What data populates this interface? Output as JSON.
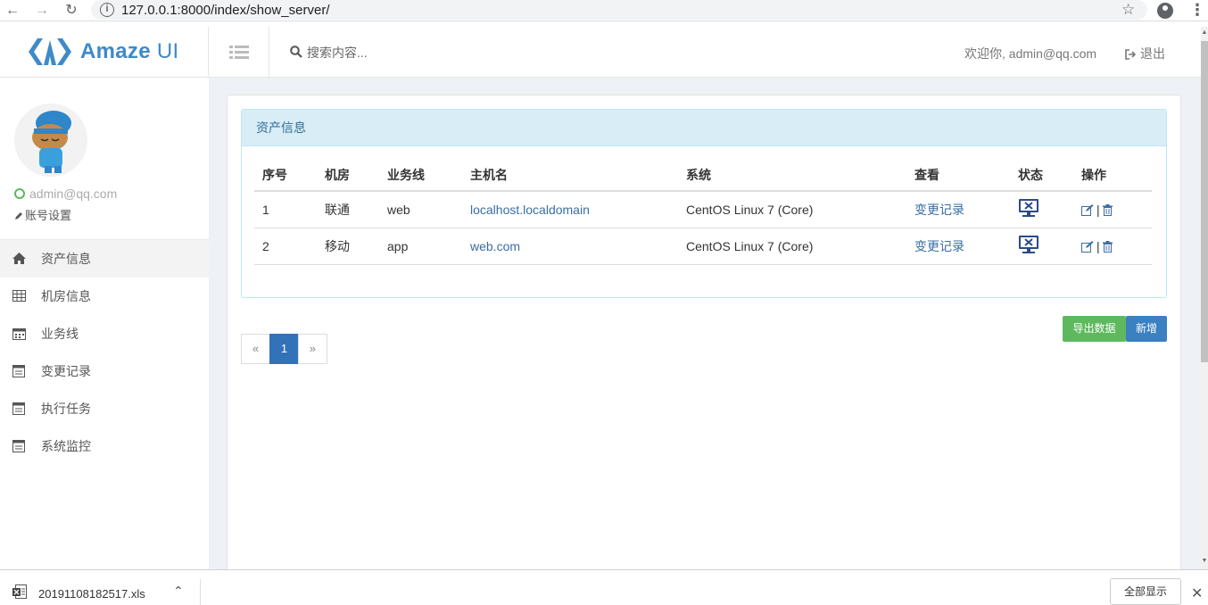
{
  "browser": {
    "url": "127.0.0.1:8000/index/show_server/",
    "back_icon": "arrow-left",
    "forward_icon": "arrow-right",
    "reload_icon": "reload"
  },
  "header": {
    "brand_name": "Amaze",
    "brand_suffix": "UI",
    "search_placeholder": "搜索内容...",
    "welcome": "欢迎你, admin@qq.com",
    "logout": "退出",
    "accent": "#3f8ac8"
  },
  "sidebar": {
    "email": "admin@qq.com",
    "account_settings": "账号设置",
    "items": [
      {
        "label": "资产信息",
        "icon": "home-icon",
        "active": true
      },
      {
        "label": "机房信息",
        "icon": "table-icon",
        "active": false
      },
      {
        "label": "业务线",
        "icon": "calendar-icon",
        "active": false
      },
      {
        "label": "变更记录",
        "icon": "list-icon",
        "active": false
      },
      {
        "label": "执行任务",
        "icon": "list-icon",
        "active": false
      },
      {
        "label": "系统监控",
        "icon": "list-icon",
        "active": false
      }
    ]
  },
  "main": {
    "panel_title": "资产信息",
    "columns": [
      "序号",
      "机房",
      "业务线",
      "主机名",
      "系统",
      "查看",
      "状态",
      "操作"
    ],
    "rows": [
      {
        "id": "1",
        "room": "联通",
        "line": "web",
        "host": "localhost.localdomain",
        "os": "CentOS Linux 7 (Core)",
        "view": "变更记录",
        "status": "offline"
      },
      {
        "id": "2",
        "room": "移动",
        "line": "app",
        "host": "web.com",
        "os": "CentOS Linux 7 (Core)",
        "view": "变更记录",
        "status": "offline"
      }
    ],
    "ops_separator": "|",
    "export_label": "导出数据",
    "add_label": "新增",
    "pager": {
      "prev": "«",
      "current": "1",
      "next": "»"
    }
  },
  "download_bar": {
    "file_name": "20191108182517.xls",
    "show_all": "全部显示"
  }
}
